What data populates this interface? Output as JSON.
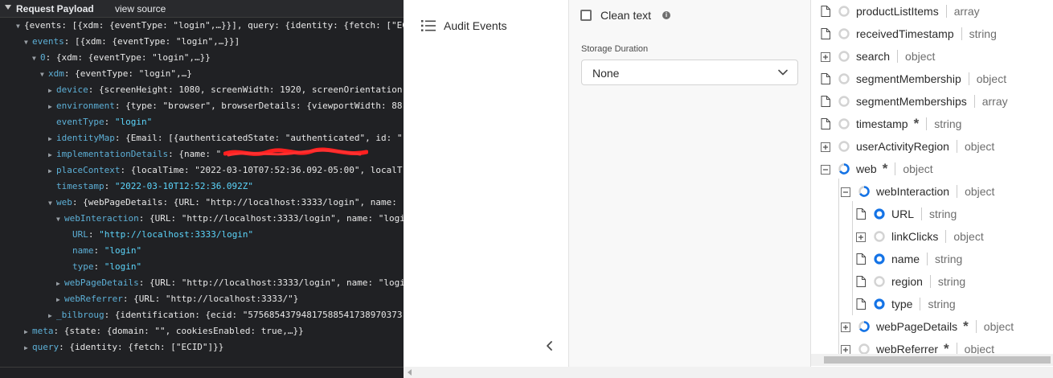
{
  "devtools": {
    "header_title": "Request Payload",
    "view_source": "view source",
    "lines": [
      {
        "indent": 0,
        "tw": "▼",
        "parts": [
          {
            "t": "{events: [{xdm: {eventType: \"login\",…}}], query: {identity: {fetch: [\"EC",
            "c": "p"
          }
        ]
      },
      {
        "indent": 1,
        "tw": "▼",
        "parts": [
          {
            "t": "events",
            "c": "k"
          },
          {
            "t": ": [{xdm: {eventType: \"login\",…}}]",
            "c": "p"
          }
        ]
      },
      {
        "indent": 2,
        "tw": "▼",
        "parts": [
          {
            "t": "0",
            "c": "k"
          },
          {
            "t": ": {xdm: {eventType: \"login\",…}}",
            "c": "p"
          }
        ]
      },
      {
        "indent": 3,
        "tw": "▼",
        "parts": [
          {
            "t": "xdm",
            "c": "k"
          },
          {
            "t": ": {eventType: \"login\",…}",
            "c": "p"
          }
        ]
      },
      {
        "indent": 4,
        "tw": "▶",
        "parts": [
          {
            "t": "device",
            "c": "k"
          },
          {
            "t": ": {screenHeight: 1080, screenWidth: 1920, screenOrientation",
            "c": "p"
          }
        ]
      },
      {
        "indent": 4,
        "tw": "▶",
        "parts": [
          {
            "t": "environment",
            "c": "k"
          },
          {
            "t": ": {type: \"browser\", browserDetails: {viewportWidth: 88",
            "c": "p"
          }
        ]
      },
      {
        "indent": 4,
        "tw": "",
        "parts": [
          {
            "t": "eventType",
            "c": "k"
          },
          {
            "t": ": ",
            "c": "p"
          },
          {
            "t": "\"login\"",
            "c": "s"
          }
        ]
      },
      {
        "indent": 4,
        "tw": "▶",
        "parts": [
          {
            "t": "identityMap",
            "c": "k"
          },
          {
            "t": ": {Email: [{authenticatedState: \"authenticated\", id: \"",
            "c": "p"
          }
        ]
      },
      {
        "indent": 4,
        "tw": "▶",
        "parts": [
          {
            "t": "implementationDetails",
            "c": "k"
          },
          {
            "t": ": {name: \"",
            "c": "p"
          }
        ]
      },
      {
        "indent": 4,
        "tw": "▶",
        "parts": [
          {
            "t": "placeContext",
            "c": "k"
          },
          {
            "t": ": {localTime: \"2022-03-10T07:52:36.092-05:00\", localT",
            "c": "p"
          }
        ]
      },
      {
        "indent": 4,
        "tw": "",
        "parts": [
          {
            "t": "timestamp",
            "c": "k"
          },
          {
            "t": ": ",
            "c": "p"
          },
          {
            "t": "\"2022-03-10T12:52:36.092Z\"",
            "c": "s"
          }
        ]
      },
      {
        "indent": 4,
        "tw": "▼",
        "parts": [
          {
            "t": "web",
            "c": "k"
          },
          {
            "t": ": {webPageDetails: {URL: \"http://localhost:3333/login\", name: ",
            "c": "p"
          }
        ]
      },
      {
        "indent": 5,
        "tw": "▼",
        "parts": [
          {
            "t": "webInteraction",
            "c": "k"
          },
          {
            "t": ": {URL: \"http://localhost:3333/login\", name: \"logi",
            "c": "p"
          }
        ]
      },
      {
        "indent": 6,
        "tw": "",
        "parts": [
          {
            "t": "URL",
            "c": "k"
          },
          {
            "t": ": ",
            "c": "p"
          },
          {
            "t": "\"http://localhost:3333/login\"",
            "c": "s"
          }
        ]
      },
      {
        "indent": 6,
        "tw": "",
        "parts": [
          {
            "t": "name",
            "c": "k"
          },
          {
            "t": ": ",
            "c": "p"
          },
          {
            "t": "\"login\"",
            "c": "s"
          }
        ]
      },
      {
        "indent": 6,
        "tw": "",
        "parts": [
          {
            "t": "type",
            "c": "k"
          },
          {
            "t": ": ",
            "c": "p"
          },
          {
            "t": "\"login\"",
            "c": "s"
          }
        ]
      },
      {
        "indent": 5,
        "tw": "▶",
        "parts": [
          {
            "t": "webPageDetails",
            "c": "k"
          },
          {
            "t": ": {URL: \"http://localhost:3333/login\", name: \"logi",
            "c": "p"
          }
        ]
      },
      {
        "indent": 5,
        "tw": "▶",
        "parts": [
          {
            "t": "webReferrer",
            "c": "k"
          },
          {
            "t": ": {URL: \"http://localhost:3333/\"}",
            "c": "p"
          }
        ]
      },
      {
        "indent": 4,
        "tw": "▶",
        "parts": [
          {
            "t": "_bilbroug",
            "c": "k"
          },
          {
            "t": ": {identification: {ecid: \"57568543794817588541738970373",
            "c": "p"
          }
        ]
      },
      {
        "indent": 1,
        "tw": "▶",
        "parts": [
          {
            "t": "meta",
            "c": "k"
          },
          {
            "t": ": {state: {domain: \"\", cookiesEnabled: true,…}}",
            "c": "p"
          }
        ]
      },
      {
        "indent": 1,
        "tw": "▶",
        "parts": [
          {
            "t": "query",
            "c": "k"
          },
          {
            "t": ": {identity: {fetch: [\"ECID\"]}}",
            "c": "p"
          }
        ]
      }
    ]
  },
  "nav": {
    "audit_events": "Audit Events",
    "icons": {
      "list": "list-icon",
      "collapse": "chevron-left-icon"
    }
  },
  "form": {
    "clean_text_label": "Clean text",
    "storage_duration_label": "Storage Duration",
    "storage_duration_value": "None",
    "clean_text_checked": false
  },
  "schema": {
    "rows": [
      {
        "level": 0,
        "icon": "doc",
        "radio": "empty",
        "name": "productListItems",
        "req": false,
        "type": "array"
      },
      {
        "level": 0,
        "icon": "doc",
        "radio": "empty",
        "name": "receivedTimestamp",
        "req": false,
        "type": "string"
      },
      {
        "level": 0,
        "icon": "plus",
        "radio": "empty",
        "name": "search",
        "req": false,
        "type": "object"
      },
      {
        "level": 0,
        "icon": "doc",
        "radio": "empty",
        "name": "segmentMembership",
        "req": false,
        "type": "object"
      },
      {
        "level": 0,
        "icon": "doc",
        "radio": "empty",
        "name": "segmentMemberships",
        "req": false,
        "type": "array"
      },
      {
        "level": 0,
        "icon": "doc",
        "radio": "empty",
        "name": "timestamp",
        "req": true,
        "type": "string"
      },
      {
        "level": 0,
        "icon": "plus",
        "radio": "empty",
        "name": "userActivityRegion",
        "req": false,
        "type": "object"
      },
      {
        "level": 0,
        "icon": "minus",
        "radio": "partial",
        "name": "web",
        "req": true,
        "type": "object"
      },
      {
        "level": 1,
        "icon": "minus",
        "radio": "partial",
        "name": "webInteraction",
        "req": false,
        "type": "object"
      },
      {
        "level": 2,
        "icon": "doc",
        "radio": "full",
        "name": "URL",
        "req": false,
        "type": "string"
      },
      {
        "level": 2,
        "icon": "plus",
        "radio": "empty",
        "name": "linkClicks",
        "req": false,
        "type": "object"
      },
      {
        "level": 2,
        "icon": "doc",
        "radio": "full",
        "name": "name",
        "req": false,
        "type": "string"
      },
      {
        "level": 2,
        "icon": "doc",
        "radio": "empty",
        "name": "region",
        "req": false,
        "type": "string"
      },
      {
        "level": 2,
        "icon": "doc",
        "radio": "full",
        "name": "type",
        "req": false,
        "type": "string"
      },
      {
        "level": 1,
        "icon": "plus",
        "radio": "partial",
        "name": "webPageDetails",
        "req": true,
        "type": "object"
      },
      {
        "level": 1,
        "icon": "plus",
        "radio": "empty",
        "name": "webReferrer",
        "req": true,
        "type": "object"
      }
    ],
    "required_marker": "*"
  },
  "colors": {
    "devtools_bg": "#202124",
    "key": "#5db0d7",
    "string": "#5cd5fb",
    "accent_blue": "#1473e6",
    "radio_empty": "#d3d3d3"
  }
}
